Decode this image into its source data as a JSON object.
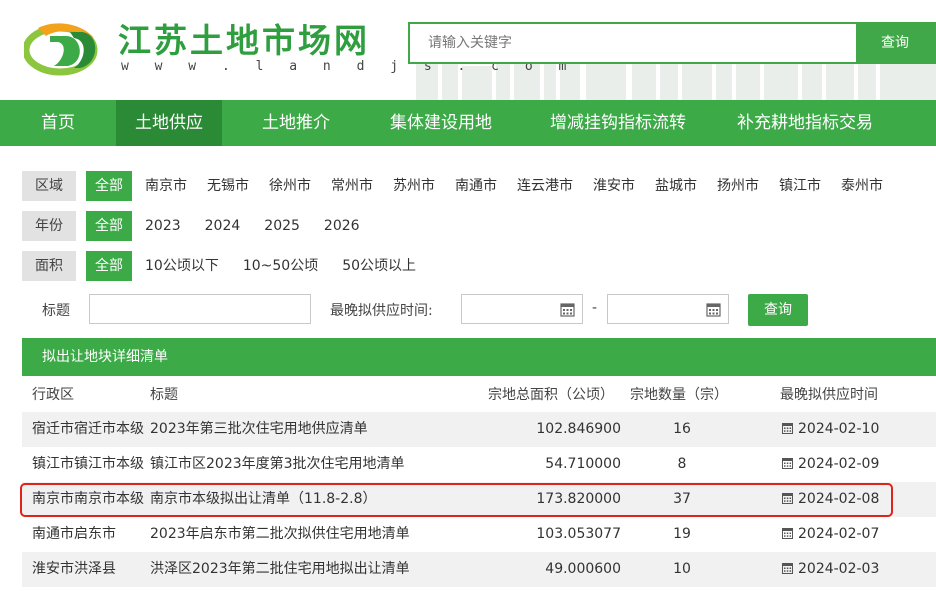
{
  "brand": {
    "title": "江苏土地市场网",
    "url": "w w w . l a n d j s . c o m",
    "accent": "#3daa48"
  },
  "search": {
    "placeholder": "请输入关键字",
    "button": "查询"
  },
  "nav": {
    "items": [
      {
        "label": "首页"
      },
      {
        "label": "土地供应",
        "active": true
      },
      {
        "label": "土地推介"
      },
      {
        "label": "集体建设用地"
      },
      {
        "label": "增减挂钩指标流转"
      },
      {
        "label": "补充耕地指标交易"
      }
    ]
  },
  "filters": {
    "region": {
      "label": "区域",
      "all": "全部",
      "options": [
        "南京市",
        "无锡市",
        "徐州市",
        "常州市",
        "苏州市",
        "南通市",
        "连云港市",
        "淮安市",
        "盐城市",
        "扬州市",
        "镇江市",
        "泰州市"
      ]
    },
    "year": {
      "label": "年份",
      "all": "全部",
      "options": [
        "2023",
        "2024",
        "2025",
        "2026"
      ]
    },
    "area": {
      "label": "面积",
      "all": "全部",
      "options": [
        "10公顷以下",
        "10~50公顷",
        "50公顷以上"
      ]
    }
  },
  "form": {
    "title_label": "标题",
    "date_label": "最晚拟供应时间:",
    "separator": "-",
    "button": "查询"
  },
  "list": {
    "heading": "拟出让地块详细清单",
    "columns": {
      "region": "行政区",
      "title": "标题",
      "area": "宗地总面积（公顷）",
      "count": "宗地数量（宗）",
      "date": "最晚拟供应时间"
    },
    "rows": [
      {
        "region": "宿迁市宿迁市本级",
        "title": "2023年第三批次住宅用地供应清单",
        "area": "102.846900",
        "count": "16",
        "date": "2024-02-10"
      },
      {
        "region": "镇江市镇江市本级",
        "title": "镇江市区2023年度第3批次住宅用地清单",
        "area": "54.710000",
        "count": "8",
        "date": "2024-02-09"
      },
      {
        "region": "南京市南京市本级",
        "title": "南京市本级拟出让清单（11.8-2.8）",
        "area": "173.820000",
        "count": "37",
        "date": "2024-02-08",
        "highlighted": true
      },
      {
        "region": "南通市启东市",
        "title": "2023年启东市第二批次拟供住宅用地清单",
        "area": "103.053077",
        "count": "19",
        "date": "2024-02-07"
      },
      {
        "region": "淮安市洪泽县",
        "title": "洪泽区2023年第二批住宅用地拟出让清单",
        "area": "49.000600",
        "count": "10",
        "date": "2024-02-03"
      }
    ]
  }
}
